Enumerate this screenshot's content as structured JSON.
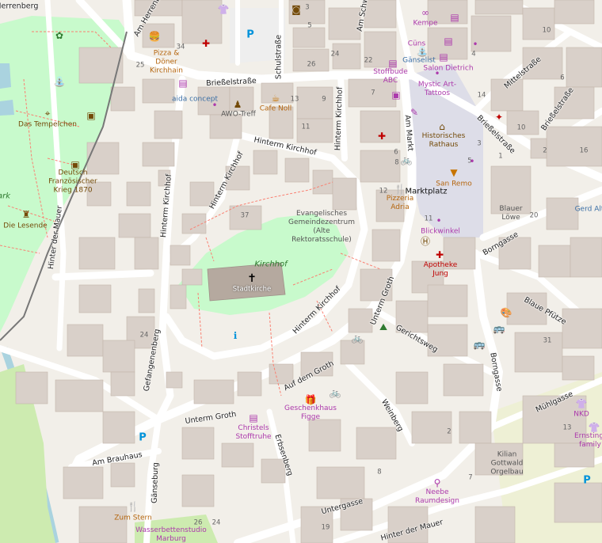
{
  "map": {
    "colors": {
      "background": "#f2efe9",
      "building": "#d9d0c9",
      "road": "#ffffff",
      "park": "#c8facc",
      "pedestrian": "#dddde8",
      "water": "#aad3df",
      "grass": "#cdebb0"
    },
    "streets": [
      "Am Herrenberg",
      "Schulstraße",
      "Am Schw",
      "Brießelstraße",
      "Mittelstraße",
      "Brießelstraße",
      "Brießelstraße",
      "Am Markt",
      "Hinterm Kirchhof",
      "Hinterm Kirchhof",
      "Hinterm Kirchhof",
      "Hinterm Kirchhof",
      "Hinterm Kirchhof",
      "Hinter der Mauer",
      "Borngasse",
      "Borngasse",
      "Blaue Pfütze",
      "Unterm Groth",
      "Unterm Groth",
      "Gerichtsweg",
      "Auf dem Groth",
      "Gefangenenberg",
      "Weinberg",
      "Mühlgasse",
      "Am Brauhaus",
      "Gänseburg",
      "Erbsenberg",
      "Untergasse",
      "Hinter der Mauer"
    ],
    "places": {
      "square": "Marktplatz",
      "park": "Kirchhof",
      "park_left": "ark"
    },
    "pois": [
      "Pizza & Döner Kirchhain",
      "aida concept",
      "AWO-Treff",
      "Cafe Noll",
      "Stoffbude ABC",
      "Kempe",
      "Cüns",
      "Gänselist",
      "Salon Dietrich",
      "Mystic Art-Tattoos",
      "Historisches Rathaus",
      "San Remo",
      "Pizzeria Adria",
      "Blickwinkel",
      "Apotheke Jung",
      "Blauer Löwe",
      "Gerd Alt",
      "Das Tempelchen",
      "Deutsch Französischer Krieg 1870",
      "Die Lesende",
      "Evangelisches Gemeindezentrum (Alte Rektoratsschule)",
      "Stadtkirche",
      "Geschenkhaus Figge",
      "Christels Stofftruhe",
      "NKD",
      "Ernsting's family",
      "Kilian Gottwald Orgelbau",
      "Neebe Raumdesign",
      "Zum Stern",
      "Wasserbettenstudio Marburg"
    ],
    "house_numbers": [
      "3",
      "5",
      "34",
      "25",
      "26",
      "24",
      "22",
      "10",
      "4",
      "6",
      "14",
      "13",
      "9",
      "11",
      "7",
      "10",
      "8",
      "6",
      "12",
      "1",
      "2",
      "16",
      "20",
      "5",
      "3",
      "37",
      "24",
      "11",
      "31",
      "13",
      "2",
      "8",
      "7",
      "26",
      "24",
      "19"
    ]
  }
}
